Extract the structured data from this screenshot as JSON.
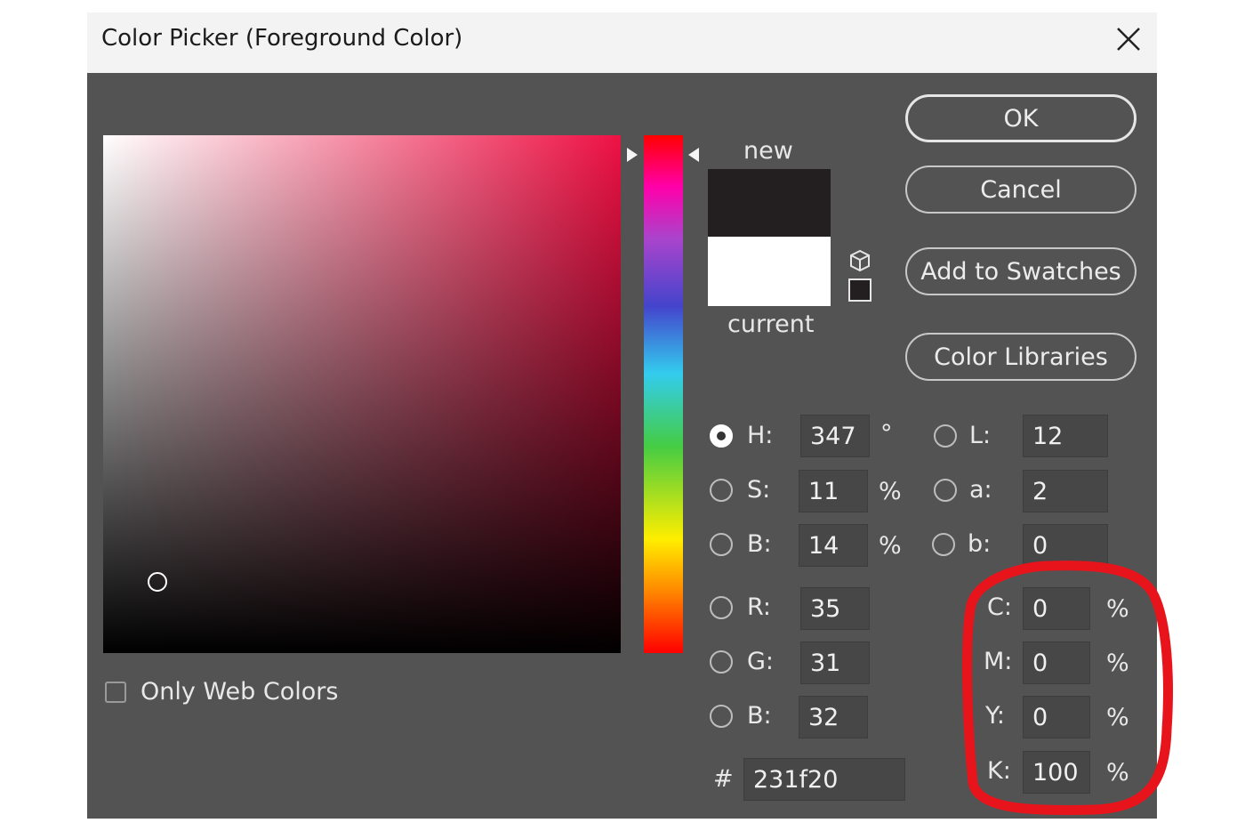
{
  "dialog": {
    "title": "Color Picker (Foreground Color)",
    "new_label": "new",
    "current_label": "current",
    "new_color": "#231f20",
    "current_color": "#ffffff",
    "only_web_colors_label": "Only Web Colors"
  },
  "buttons": {
    "ok": "OK",
    "cancel": "Cancel",
    "add_to_swatches": "Add to Swatches",
    "color_libraries": "Color Libraries"
  },
  "hsb": {
    "h_label": "H:",
    "h_value": "347",
    "h_unit": "°",
    "s_label": "S:",
    "s_value": "11",
    "s_unit": "%",
    "b_label": "B:",
    "b_value": "14",
    "b_unit": "%"
  },
  "rgb": {
    "r_label": "R:",
    "r_value": "35",
    "g_label": "G:",
    "g_value": "31",
    "b_label": "B:",
    "b_value": "32"
  },
  "lab": {
    "l_label": "L:",
    "l_value": "12",
    "a_label": "a:",
    "a_value": "2",
    "b_label": "b:",
    "b_value": "0"
  },
  "cmyk": {
    "c_label": "C:",
    "c_value": "0",
    "c_unit": "%",
    "m_label": "M:",
    "m_value": "0",
    "m_unit": "%",
    "y_label": "Y:",
    "y_value": "0",
    "y_unit": "%",
    "k_label": "K:",
    "k_value": "100",
    "k_unit": "%"
  },
  "hex": {
    "label": "#",
    "value": "231f20"
  },
  "annotation_color": "#e8141c",
  "icons": [
    "close-icon",
    "cube-icon",
    "web-safe-square-icon"
  ]
}
